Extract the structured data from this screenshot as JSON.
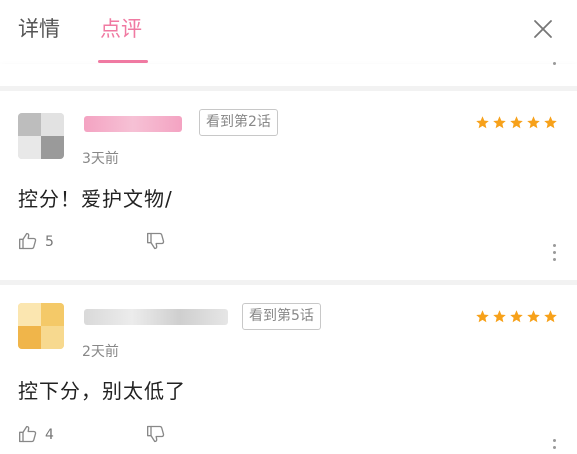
{
  "tabs": [
    {
      "label": "详情",
      "active": false
    },
    {
      "label": "点评",
      "active": true
    }
  ],
  "accent_color": "#f07aa2",
  "star_color": "#f7a11a",
  "reviews": [
    {
      "progress_badge": "看到第2话",
      "rating": 5,
      "time": "3天前",
      "content": "控分！爱护文物/",
      "likes": "5"
    },
    {
      "progress_badge": "看到第5话",
      "rating": 5,
      "time": "2天前",
      "content": "控下分，别太低了",
      "likes": "4"
    }
  ],
  "icons": {
    "close": "close-icon",
    "like": "thumbs-up-icon",
    "dislike": "thumbs-down-icon",
    "more": "more-vertical-icon",
    "star": "star-icon"
  }
}
